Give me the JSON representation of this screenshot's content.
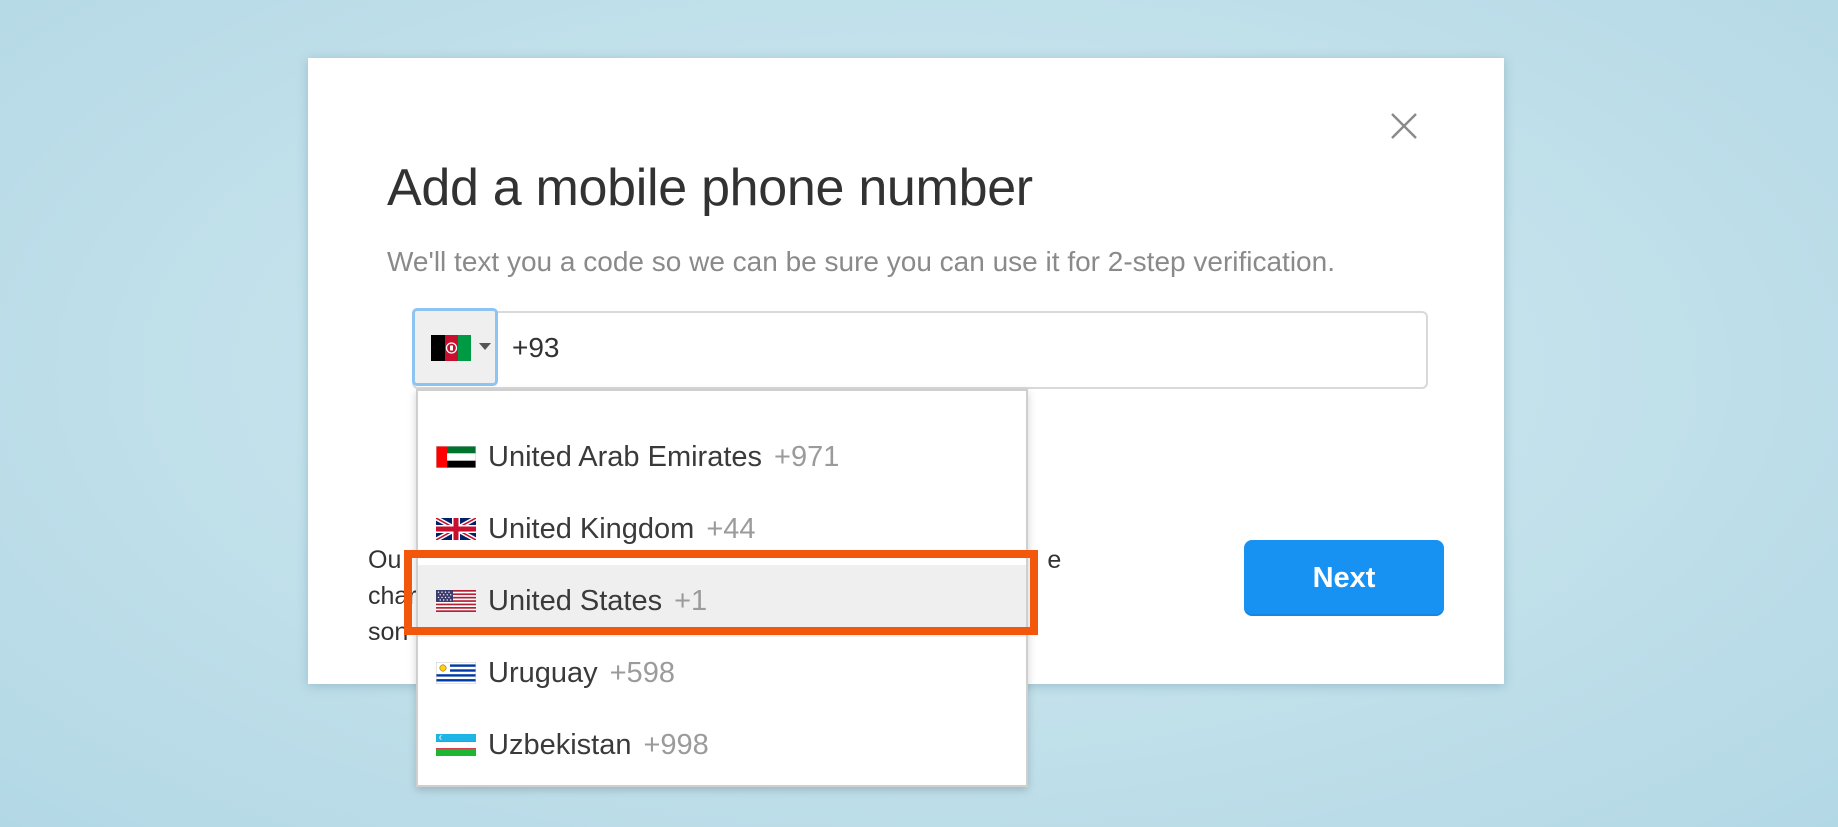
{
  "dialog": {
    "title": "Add a mobile phone number",
    "subtitle": "We'll text you a code so we can be sure you can use it for 2-step verification.",
    "close_icon": "close-icon"
  },
  "phone": {
    "selected_country_flag": "afghanistan-flag-icon",
    "value": "+93"
  },
  "disclaimer": {
    "visible_start": "Ou",
    "visible_start_line2": "son",
    "visible_end": "e charges in"
  },
  "actions": {
    "next_label": "Next"
  },
  "dropdown": {
    "options": [
      {
        "name": "United Arab Emirates",
        "code": "+971",
        "flag": "uae-flag-icon"
      },
      {
        "name": "United Kingdom",
        "code": "+44",
        "flag": "uk-flag-icon"
      },
      {
        "name": "United States",
        "code": "+1",
        "flag": "us-flag-icon",
        "selected": true
      },
      {
        "name": "Uruguay",
        "code": "+598",
        "flag": "uruguay-flag-icon"
      },
      {
        "name": "Uzbekistan",
        "code": "+998",
        "flag": "uzbekistan-flag-icon"
      }
    ]
  },
  "colors": {
    "primary_button": "#1892f2",
    "focus_ring": "#8ec4f2",
    "annotation": "#f2570b",
    "background": "#c4e2ec"
  }
}
